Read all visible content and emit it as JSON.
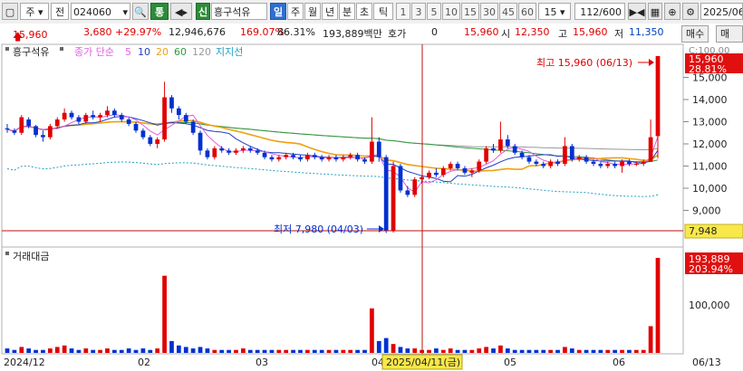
{
  "toolbar": {
    "mode": "주",
    "stock_type": "전",
    "code": "024060",
    "search_icon": "search-icon",
    "link_btn": "통",
    "sound_icon": "speaker-icon",
    "credit_badge": "신",
    "stock_name": "흥구석유",
    "periods": [
      "일",
      "주",
      "월",
      "년",
      "분",
      "초",
      "틱"
    ],
    "active_period": "일",
    "intervals": [
      "1",
      "3",
      "5",
      "10",
      "15",
      "30",
      "45",
      "60"
    ],
    "interval_value": "15",
    "count_display": "112/600",
    "date_value": "2025/06"
  },
  "quote": {
    "price": "15,960",
    "change": "3,680",
    "change_pct": "+29.97%",
    "volume": "12,946,676",
    "volume_ratio": "169.07%",
    "turnover": "86.31%",
    "amount": "193,889백만",
    "hoga_label": "호가",
    "hoga_value": "0",
    "price2": "15,960",
    "open_label": "시",
    "open": "12,350",
    "high_label": "고",
    "high": "15,960",
    "low_label": "저",
    "low": "11,350",
    "buy_btn": "매수",
    "sell_btn": "매도"
  },
  "legend": {
    "name": "흥구석유",
    "ma_label": "종가 단순",
    "ma5": "5",
    "ma10": "10",
    "ma20": "20",
    "ma60": "60",
    "ma120": "120",
    "support": "지지선",
    "c_label": "C:100.00"
  },
  "colors": {
    "up": "#e00000",
    "down": "#0030d0",
    "ma5": "#e060e0",
    "ma10": "#1f3fbf",
    "ma20": "#f0a010",
    "ma60": "#2e9a3a",
    "ma120": "#999999",
    "support": "#20a0c0"
  },
  "price_axis": {
    "labels": [
      "15,000",
      "14,000",
      "13,000",
      "12,000",
      "11,000",
      "10,000",
      "9,000"
    ],
    "current": "15,960",
    "current_pct": "28.81%",
    "low_box": "7,948"
  },
  "annotations": {
    "high": "최고 15,960 (06/13)",
    "low": "최저 7,980 (04/03)"
  },
  "volume_pane": {
    "title": "거래대금",
    "current": "193,889",
    "current_pct": "203.94%",
    "axis_label": "100,000"
  },
  "date_axis": {
    "labels": [
      "2024/12",
      "02",
      "03",
      "04",
      "05",
      "06",
      "06/13"
    ],
    "crosshair": "2025/04/11(금)"
  },
  "chart_data": {
    "type": "candlestick",
    "ylim": [
      7500,
      16000
    ],
    "candles": [
      [
        12700,
        12900,
        12500,
        12650
      ],
      [
        12600,
        12700,
        12400,
        12500
      ],
      [
        12500,
        13300,
        12400,
        13200
      ],
      [
        13100,
        13200,
        12700,
        12800
      ],
      [
        12800,
        12850,
        12300,
        12400
      ],
      [
        12400,
        12600,
        12100,
        12300
      ],
      [
        12300,
        12900,
        12200,
        12800
      ],
      [
        12800,
        13200,
        12700,
        13100
      ],
      [
        13100,
        13600,
        13000,
        13400
      ],
      [
        13400,
        13500,
        13100,
        13200
      ],
      [
        13200,
        13300,
        12900,
        13000
      ],
      [
        13000,
        13400,
        12900,
        13300
      ],
      [
        13300,
        13500,
        13100,
        13200
      ],
      [
        13200,
        13400,
        13000,
        13300
      ],
      [
        13300,
        13700,
        13200,
        13500
      ],
      [
        13500,
        13600,
        13200,
        13300
      ],
      [
        13300,
        13400,
        13000,
        13100
      ],
      [
        13100,
        13200,
        12800,
        12900
      ],
      [
        12900,
        13000,
        12500,
        12600
      ],
      [
        12600,
        12700,
        12200,
        12300
      ],
      [
        12300,
        12400,
        11900,
        12000
      ],
      [
        12000,
        12300,
        11800,
        12200
      ],
      [
        12200,
        14800,
        12100,
        14100
      ],
      [
        14100,
        14200,
        13400,
        13600
      ],
      [
        13600,
        13700,
        13100,
        13300
      ],
      [
        13300,
        13400,
        12900,
        13000
      ],
      [
        13000,
        13100,
        12400,
        12500
      ],
      [
        12500,
        12600,
        11500,
        11700
      ],
      [
        11700,
        11800,
        11300,
        11400
      ],
      [
        11400,
        11900,
        11300,
        11800
      ],
      [
        11800,
        11900,
        11600,
        11700
      ],
      [
        11700,
        11800,
        11500,
        11600
      ],
      [
        11600,
        11800,
        11500,
        11700
      ],
      [
        11700,
        11900,
        11600,
        11800
      ],
      [
        11800,
        11900,
        11600,
        11700
      ],
      [
        11700,
        11800,
        11500,
        11600
      ],
      [
        11600,
        11700,
        11300,
        11400
      ],
      [
        11400,
        11500,
        11200,
        11300
      ],
      [
        11300,
        11500,
        11200,
        11400
      ],
      [
        11400,
        11600,
        11300,
        11500
      ],
      [
        11500,
        11600,
        11300,
        11400
      ],
      [
        11400,
        11500,
        11200,
        11300
      ],
      [
        11300,
        11600,
        11200,
        11500
      ],
      [
        11500,
        11600,
        11300,
        11400
      ],
      [
        11400,
        11500,
        11200,
        11300
      ],
      [
        11300,
        11500,
        11200,
        11400
      ],
      [
        11400,
        11500,
        11200,
        11300
      ],
      [
        11300,
        11500,
        11200,
        11400
      ],
      [
        11400,
        11600,
        11300,
        11500
      ],
      [
        11500,
        11600,
        11200,
        11300
      ],
      [
        11300,
        11400,
        11100,
        11200
      ],
      [
        11200,
        13200,
        11100,
        12100
      ],
      [
        12100,
        12300,
        11200,
        11400
      ],
      [
        11400,
        11500,
        7980,
        8100
      ],
      [
        8100,
        11200,
        8000,
        11000
      ],
      [
        11000,
        11100,
        9800,
        9900
      ],
      [
        9900,
        10100,
        9600,
        9700
      ],
      [
        9700,
        10500,
        9600,
        10400
      ],
      [
        10400,
        10600,
        10200,
        10500
      ],
      [
        10500,
        10800,
        10400,
        10700
      ],
      [
        10700,
        10900,
        10500,
        10600
      ],
      [
        10600,
        11000,
        10500,
        10900
      ],
      [
        10900,
        11200,
        10800,
        11100
      ],
      [
        11100,
        11200,
        10800,
        10900
      ],
      [
        10900,
        11000,
        10600,
        10700
      ],
      [
        10700,
        10900,
        10500,
        10800
      ],
      [
        10800,
        11300,
        10700,
        11200
      ],
      [
        11200,
        11900,
        11100,
        11800
      ],
      [
        11800,
        12000,
        11600,
        11700
      ],
      [
        11700,
        13000,
        11600,
        12200
      ],
      [
        12200,
        12400,
        11800,
        11900
      ],
      [
        11900,
        12000,
        11500,
        11600
      ],
      [
        11600,
        11700,
        11300,
        11400
      ],
      [
        11400,
        11500,
        11100,
        11200
      ],
      [
        11200,
        11300,
        11000,
        11100
      ],
      [
        11100,
        11200,
        10900,
        11000
      ],
      [
        11000,
        11300,
        10900,
        11200
      ],
      [
        11200,
        11300,
        11000,
        11100
      ],
      [
        11100,
        12300,
        11000,
        11900
      ],
      [
        11900,
        12000,
        11200,
        11300
      ],
      [
        11300,
        11500,
        11200,
        11400
      ],
      [
        11400,
        11500,
        11100,
        11200
      ],
      [
        11200,
        11300,
        11000,
        11100
      ],
      [
        11100,
        11200,
        10900,
        11000
      ],
      [
        11000,
        11200,
        10900,
        11100
      ],
      [
        11100,
        11200,
        10900,
        11000
      ],
      [
        11000,
        11300,
        10700,
        11200
      ],
      [
        11200,
        11300,
        11000,
        11100
      ],
      [
        11100,
        11200,
        11000,
        11100
      ],
      [
        11100,
        11300,
        11000,
        11200
      ],
      [
        11200,
        13100,
        11200,
        12300
      ],
      [
        12350,
        15960,
        11350,
        15960
      ]
    ],
    "volumes": [
      3,
      2,
      4,
      3,
      2,
      2,
      3,
      4,
      5,
      3,
      2,
      3,
      2,
      2,
      3,
      2,
      2,
      3,
      2,
      3,
      2,
      3,
      52,
      8,
      5,
      4,
      3,
      4,
      3,
      2,
      2,
      2,
      2,
      3,
      2,
      2,
      2,
      2,
      2,
      2,
      2,
      2,
      2,
      2,
      2,
      2,
      2,
      2,
      2,
      2,
      2,
      30,
      8,
      10,
      6,
      4,
      3,
      3,
      2,
      2,
      3,
      2,
      3,
      2,
      2,
      2,
      3,
      4,
      3,
      5,
      3,
      2,
      2,
      2,
      2,
      2,
      2,
      2,
      4,
      3,
      2,
      2,
      2,
      2,
      2,
      2,
      2,
      2,
      2,
      2,
      18,
      64
    ]
  }
}
